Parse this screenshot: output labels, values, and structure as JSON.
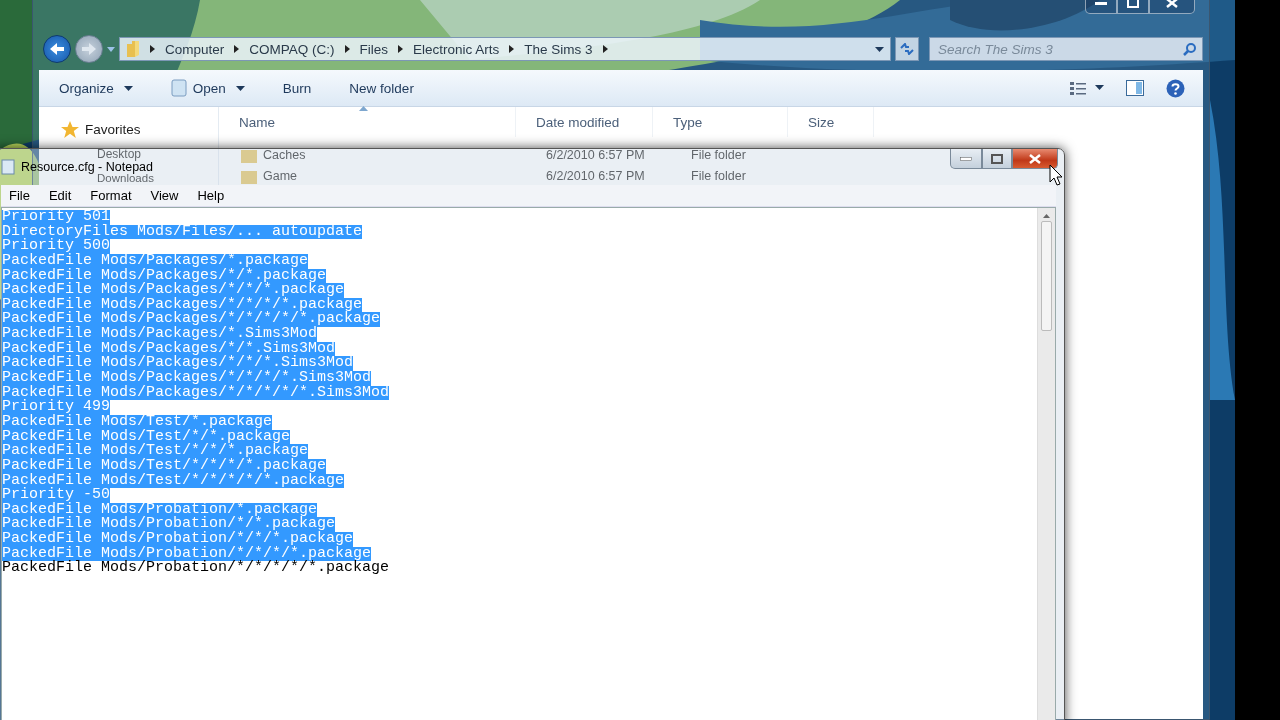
{
  "explorer": {
    "breadcrumb": [
      "Computer",
      "COMPAQ (C:)",
      "Files",
      "Electronic Arts",
      "The Sims 3"
    ],
    "search": {
      "placeholder": "Search The Sims 3"
    },
    "toolbar": [
      {
        "label": "Organize",
        "has_menu": true,
        "kind": "menu"
      },
      {
        "label": "Open",
        "has_menu": true,
        "kind": "open"
      },
      {
        "label": "Burn",
        "has_menu": false,
        "kind": "plain"
      },
      {
        "label": "New folder",
        "has_menu": false,
        "kind": "plain"
      }
    ],
    "favorites": "Favorites",
    "nav_items": [
      "Desktop",
      "Downloads"
    ],
    "columns": [
      {
        "label": "Name",
        "sorted": true
      },
      {
        "label": "Date modified",
        "sorted": false
      },
      {
        "label": "Type",
        "sorted": false
      },
      {
        "label": "Size",
        "sorted": false
      }
    ],
    "rows": [
      {
        "name": "Caches",
        "date": "6/2/2010 6:57 PM",
        "type": "File folder"
      },
      {
        "name": "Game",
        "date": "6/2/2010 6:57 PM",
        "type": "File folder"
      }
    ]
  },
  "notepad": {
    "title": "Resource.cfg - Notepad",
    "menu": [
      "File",
      "Edit",
      "Format",
      "View",
      "Help"
    ],
    "lines": [
      {
        "text": "Priority 501",
        "selected": true
      },
      {
        "text": "DirectoryFiles Mods/Files/... autoupdate",
        "selected": true
      },
      {
        "text": "Priority 500",
        "selected": true
      },
      {
        "text": "PackedFile Mods/Packages/*.package",
        "selected": true
      },
      {
        "text": "PackedFile Mods/Packages/*/*.package",
        "selected": true
      },
      {
        "text": "PackedFile Mods/Packages/*/*/*.package",
        "selected": true
      },
      {
        "text": "PackedFile Mods/Packages/*/*/*/*.package",
        "selected": true
      },
      {
        "text": "PackedFile Mods/Packages/*/*/*/*/*.package",
        "selected": true
      },
      {
        "text": "PackedFile Mods/Packages/*.Sims3Mod",
        "selected": true
      },
      {
        "text": "PackedFile Mods/Packages/*/*.Sims3Mod",
        "selected": true
      },
      {
        "text": "PackedFile Mods/Packages/*/*/*.Sims3Mod",
        "selected": true
      },
      {
        "text": "PackedFile Mods/Packages/*/*/*/*.Sims3Mod",
        "selected": true
      },
      {
        "text": "PackedFile Mods/Packages/*/*/*/*/*.Sims3Mod",
        "selected": true
      },
      {
        "text": "Priority 499",
        "selected": true
      },
      {
        "text": "PackedFile Mods/Test/*.package",
        "selected": true
      },
      {
        "text": "PackedFile Mods/Test/*/*.package",
        "selected": true
      },
      {
        "text": "PackedFile Mods/Test/*/*/*.package",
        "selected": true
      },
      {
        "text": "PackedFile Mods/Test/*/*/*/*.package",
        "selected": true
      },
      {
        "text": "PackedFile Mods/Test/*/*/*/*/*.package",
        "selected": true
      },
      {
        "text": "Priority -50",
        "selected": true
      },
      {
        "text": "PackedFile Mods/Probation/*.package",
        "selected": true
      },
      {
        "text": "PackedFile Mods/Probation/*/*.package",
        "selected": true
      },
      {
        "text": "PackedFile Mods/Probation/*/*/*.package",
        "selected": true
      },
      {
        "text": "PackedFile Mods/Probation/*/*/*/*.package",
        "selected": true
      },
      {
        "text": "PackedFile Mods/Probation/*/*/*/*/*.package",
        "selected": false
      }
    ]
  }
}
